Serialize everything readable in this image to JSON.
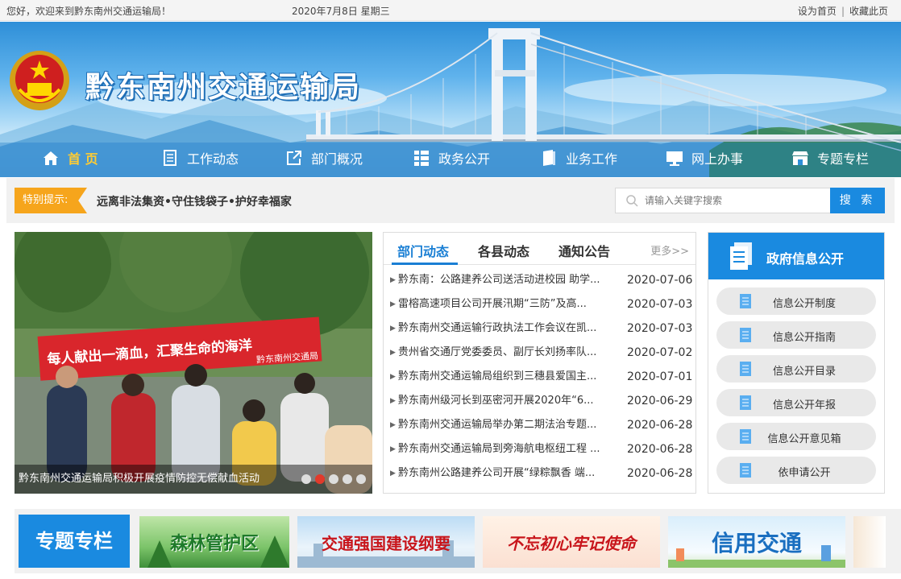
{
  "topbar": {
    "welcome": "您好，欢迎来到黔东南州交通运输局！",
    "date": "2020年7月8日 星期三",
    "set_home": "设为首页",
    "separator": "|",
    "bookmark": "收藏此页"
  },
  "header": {
    "title": "黔东南州交通运输局"
  },
  "nav": {
    "items": [
      {
        "label": "首 页",
        "icon": "home-icon"
      },
      {
        "label": "工作动态",
        "icon": "document-icon"
      },
      {
        "label": "部门概况",
        "icon": "external-link-icon"
      },
      {
        "label": "政务公开",
        "icon": "grid-list-icon"
      },
      {
        "label": "业务工作",
        "icon": "book-icon"
      },
      {
        "label": "网上办事",
        "icon": "monitor-icon"
      },
      {
        "label": "专题专栏",
        "icon": "shop-icon"
      }
    ]
  },
  "notice": {
    "tag": "特别提示:",
    "text": "远离非法集资•守住钱袋子•护好幸福家"
  },
  "search": {
    "placeholder": "请输入关键字搜索",
    "button": "搜 索"
  },
  "carousel": {
    "banner_text": "每人献出一滴血，汇聚生命的海洋",
    "banner_sub": "黔东南州交通局",
    "caption": "黔东南州交通运输局积极开展疫情防控无偿献血活动",
    "active_index": 1
  },
  "news": {
    "tabs": [
      "部门动态",
      "各县动态",
      "通知公告"
    ],
    "more": "更多>>",
    "items": [
      {
        "title": "黔东南：公路建养公司送活动进校园 助学...",
        "date": "2020-07-06"
      },
      {
        "title": "雷榕高速项目公司开展汛期“三防”及高...",
        "date": "2020-07-03"
      },
      {
        "title": "黔东南州交通运输行政执法工作会议在凯...",
        "date": "2020-07-03"
      },
      {
        "title": "贵州省交通厅党委委员、副厅长刘扬率队...",
        "date": "2020-07-02"
      },
      {
        "title": "黔东南州交通运输局组织到三穗县爱国主...",
        "date": "2020-07-01"
      },
      {
        "title": "黔东南州级河长到巫密河开展2020年“6...",
        "date": "2020-06-29"
      },
      {
        "title": "黔东南州交通运输局举办第二期法治专题...",
        "date": "2020-06-28"
      },
      {
        "title": "黔东南州交通运输局到旁海航电枢纽工程 ...",
        "date": "2020-06-28"
      },
      {
        "title": "黔东南州公路建养公司开展“绿粽飘香 端...",
        "date": "2020-06-28"
      }
    ]
  },
  "gov_info": {
    "title": "政府信息公开",
    "buttons": [
      "信息公开制度",
      "信息公开指南",
      "信息公开目录",
      "信息公开年报",
      "信息公开意见箱",
      "依申请公开"
    ]
  },
  "topics": {
    "title": "专题专栏",
    "banners": [
      {
        "label": "森林管护区",
        "color": "#1e7a2a"
      },
      {
        "label": "交通强国建设纲要",
        "color": "#c8151b"
      },
      {
        "label": "不忘初心牢记使命",
        "color": "#c8151b"
      },
      {
        "label": "信用交通",
        "color": "#1a6fc0"
      }
    ]
  },
  "colors": {
    "primary": "#1a8ae0",
    "accent_orange": "#f6a51c",
    "nav_active": "#ffcc33",
    "dot_active": "#e23a2b"
  }
}
